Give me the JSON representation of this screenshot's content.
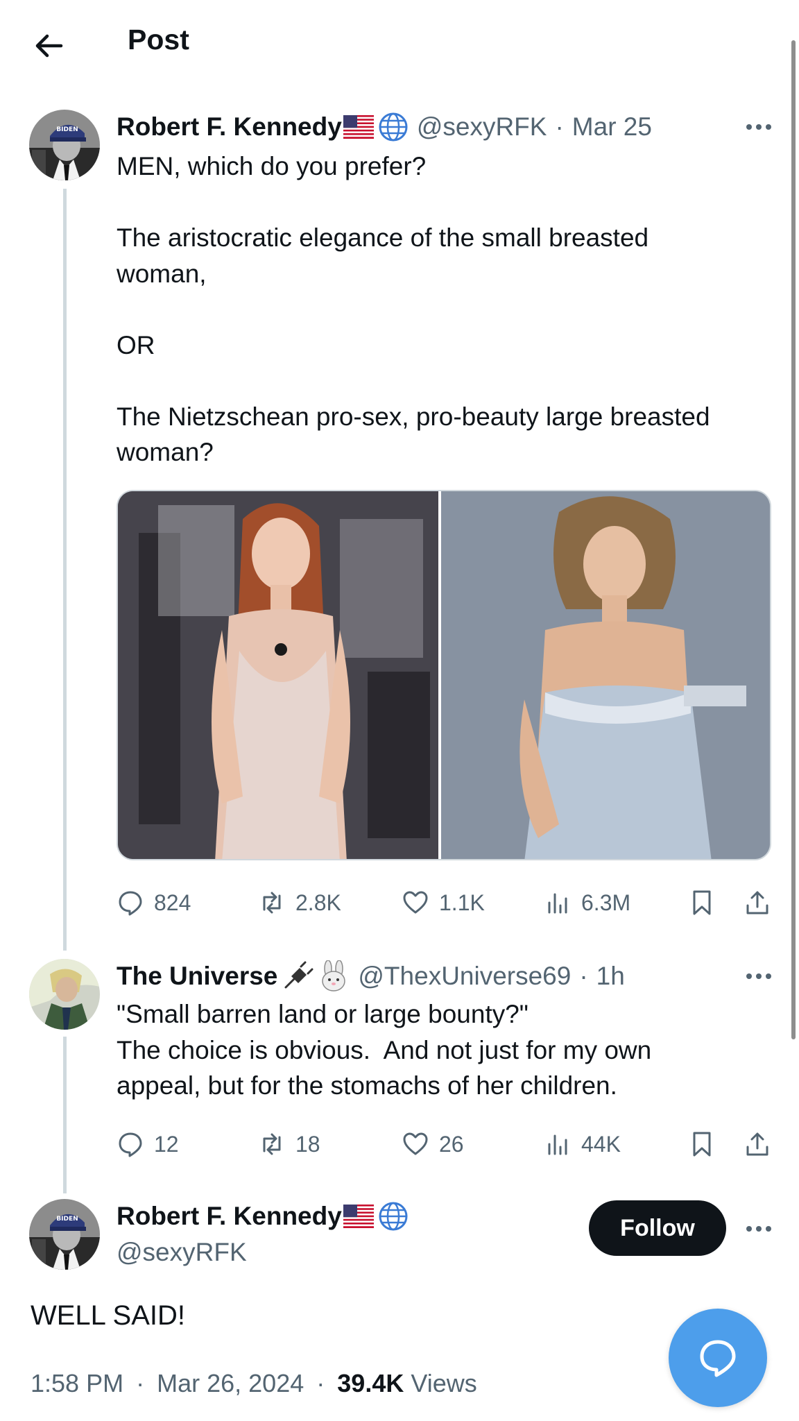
{
  "header": {
    "title": "Post"
  },
  "original_post": {
    "author_name": "Robert F. Kennedy",
    "handle": "@sexyRFK",
    "separator": "·",
    "time": "Mar 25",
    "lines": [
      "MEN, which do you prefer?",
      "The aristocratic elegance of the small breasted",
      "woman,",
      "OR",
      "The Nietzschean pro-sex, pro-beauty large breasted",
      "woman?"
    ],
    "stats": {
      "replies": "824",
      "reposts": "2.8K",
      "likes": "1.1K",
      "views": "6.3M"
    }
  },
  "reply": {
    "author_name": "The Universe",
    "handle": "@ThexUniverse69",
    "separator": "·",
    "time": "1h",
    "lines": [
      "\"Small barren land or large bounty?\"",
      "The choice is obvious.  And not just for my own",
      "appeal, but for the stomachs of her children."
    ],
    "stats": {
      "replies": "12",
      "reposts": "18",
      "likes": "26",
      "views": "44K"
    }
  },
  "main_post": {
    "author_name": "Robert F. Kennedy",
    "handle": "@sexyRFK",
    "follow_label": "Follow",
    "text": "WELL SAID!",
    "time": "1:58 PM",
    "sep1": "·",
    "date": "Mar 26, 2024",
    "sep2": "·",
    "views_count": "39.4K",
    "views_label": "Views"
  },
  "colors": {
    "accent": "#4d9eeb",
    "text": "#0f1419",
    "muted": "#536471",
    "thread_line": "#cfd9de"
  },
  "icons": [
    "back-arrow-icon",
    "us-flag-icon",
    "globe-icon",
    "more-icon",
    "reply-icon",
    "repost-icon",
    "like-icon",
    "views-icon",
    "bookmark-icon",
    "share-icon",
    "compose-reply-icon"
  ]
}
